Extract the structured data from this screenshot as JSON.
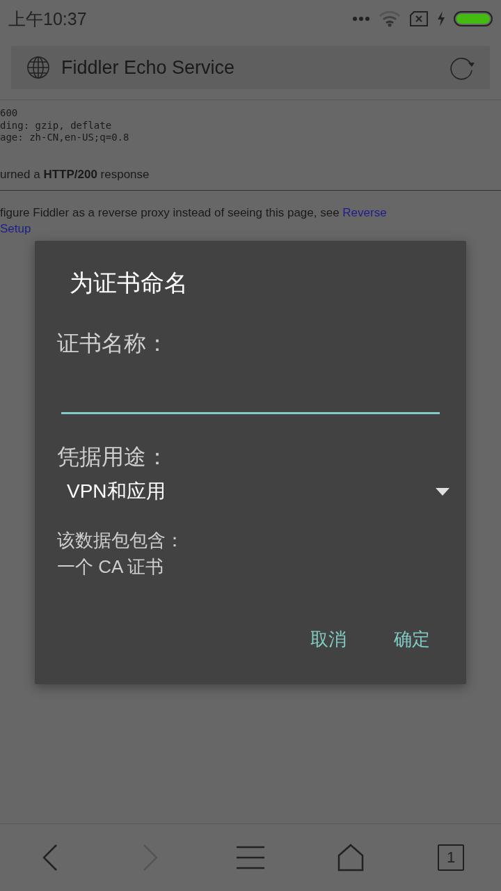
{
  "status_bar": {
    "time": "上午10:37"
  },
  "address_bar": {
    "title": "Fiddler Echo Service"
  },
  "page": {
    "code_lines": [
      "600",
      "ding: gzip, deflate",
      "age: zh-CN,en-US;q=0.8"
    ],
    "response": "urned a **HTTP/200** response",
    "lines": [
      {
        "parts": [
          {
            "kind": "text",
            "text": "figure Fiddler as a reverse proxy instead of seeing this page, see "
          },
          {
            "kind": "link",
            "text": "Reverse"
          }
        ]
      },
      {
        "parts": [
          {
            "kind": "link",
            "text": "Setup"
          }
        ]
      }
    ]
  },
  "dialog": {
    "title": "为证书命名",
    "name_label": "证书名称：",
    "usage_label": "凭据用途：",
    "usage_value": "VPN和应用",
    "contents_label": "该数据包包含：",
    "contents_value": "一个 CA 证书",
    "buttons": [
      "取消",
      "确定"
    ]
  },
  "nav_bar": [
    {
      "kind": "back",
      "disabled": false
    },
    {
      "kind": "forward",
      "disabled": true
    },
    {
      "kind": "menu",
      "disabled": false
    },
    {
      "kind": "home",
      "disabled": false
    },
    {
      "kind": "tabs",
      "label": "1",
      "disabled": false
    }
  ]
}
